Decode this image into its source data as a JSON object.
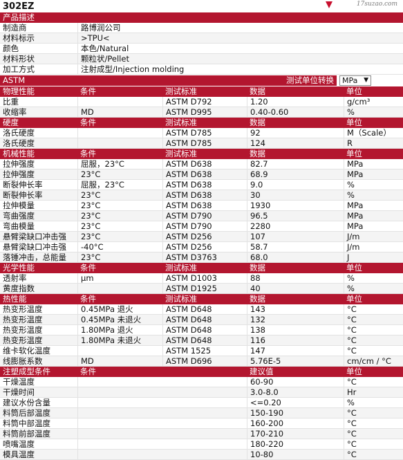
{
  "grade": "302EZ",
  "logo_text": "17suzao.com",
  "description": {
    "title": "产品描述",
    "rows": [
      {
        "label": "制造商",
        "value": "路博润公司"
      },
      {
        "label": "材料标示",
        "value": ">TPU<"
      },
      {
        "label": "颜色",
        "value": "本色/Natural"
      },
      {
        "label": "材料形状",
        "value": "颗粒状/Pellet"
      },
      {
        "label": "加工方式",
        "value": "注射成型/Injection molding"
      }
    ]
  },
  "astm_bar": {
    "label": "ASTM",
    "switch_label": "测试单位转换",
    "selected_unit": "MPa"
  },
  "sections": [
    {
      "title": "物理性能",
      "h_cond": "条件",
      "h_std": "测试标准",
      "h_data": "数据",
      "h_unit": "单位",
      "rows": [
        {
          "name": "比重",
          "cond": "",
          "std": "ASTM D792",
          "data": "1.20",
          "unit": "g/cm³"
        },
        {
          "name": "收缩率",
          "cond": "MD",
          "std": "ASTM D995",
          "data": "0.40-0.60",
          "unit": "%"
        }
      ]
    },
    {
      "title": "硬度",
      "h_cond": "条件",
      "h_std": "测试标准",
      "h_data": "数据",
      "h_unit": "单位",
      "rows": [
        {
          "name": "洛氏硬度",
          "cond": "",
          "std": "ASTM D785",
          "data": "92",
          "unit": "M（Scale）"
        },
        {
          "name": "洛氏硬度",
          "cond": "",
          "std": "ASTM D785",
          "data": "124",
          "unit": "R"
        }
      ]
    },
    {
      "title": "机械性能",
      "h_cond": "条件",
      "h_std": "测试标准",
      "h_data": "数据",
      "h_unit": "单位",
      "rows": [
        {
          "name": "拉伸强度",
          "cond": "屈服，23°C",
          "std": "ASTM D638",
          "data": "82.7",
          "unit": "MPa"
        },
        {
          "name": "拉伸强度",
          "cond": "23°C",
          "std": "ASTM D638",
          "data": "68.9",
          "unit": "MPa"
        },
        {
          "name": "断裂伸长率",
          "cond": "屈服，23°C",
          "std": "ASTM D638",
          "data": "9.0",
          "unit": "%"
        },
        {
          "name": "断裂伸长率",
          "cond": "23°C",
          "std": "ASTM D638",
          "data": "30",
          "unit": "%"
        },
        {
          "name": "拉伸模量",
          "cond": "23°C",
          "std": "ASTM D638",
          "data": "1930",
          "unit": "MPa"
        },
        {
          "name": "弯曲强度",
          "cond": "23°C",
          "std": "ASTM D790",
          "data": "96.5",
          "unit": "MPa"
        },
        {
          "name": "弯曲模量",
          "cond": "23°C",
          "std": "ASTM D790",
          "data": "2280",
          "unit": "MPa"
        },
        {
          "name": "悬臂梁缺口冲击强",
          "cond": "23°C",
          "std": "ASTM D256",
          "data": "107",
          "unit": "J/m"
        },
        {
          "name": "悬臂梁缺口冲击强",
          "cond": "-40°C",
          "std": "ASTM D256",
          "data": "58.7",
          "unit": "J/m"
        },
        {
          "name": "落锤冲击，总能量",
          "cond": "23°C",
          "std": "ASTM D3763",
          "data": "68.0",
          "unit": "J"
        }
      ]
    },
    {
      "title": "光学性能",
      "h_cond": "条件",
      "h_std": "测试标准",
      "h_data": "数据",
      "h_unit": "单位",
      "rows": [
        {
          "name": "透射率",
          "cond": "μm",
          "std": "ASTM D1003",
          "data": "88",
          "unit": "%"
        },
        {
          "name": "黄度指数",
          "cond": "",
          "std": "ASTM D1925",
          "data": "40",
          "unit": "%"
        }
      ]
    },
    {
      "title": "热性能",
      "h_cond": "条件",
      "h_std": "测试标准",
      "h_data": "数据",
      "h_unit": "单位",
      "rows": [
        {
          "name": "热变形温度",
          "cond": "0.45MPa 退火",
          "std": "ASTM D648",
          "data": "143",
          "unit": "°C"
        },
        {
          "name": "热变形温度",
          "cond": "0.45MPa 未退火",
          "std": "ASTM D648",
          "data": "132",
          "unit": "°C"
        },
        {
          "name": "热变形温度",
          "cond": "1.80MPa 退火",
          "std": "ASTM D648",
          "data": "138",
          "unit": "°C"
        },
        {
          "name": "热变形温度",
          "cond": "1.80MPa 未退火",
          "std": "ASTM D648",
          "data": "116",
          "unit": "°C"
        },
        {
          "name": "维卡软化温度",
          "cond": "",
          "std": "ASTM 1525",
          "data": "147",
          "unit": "°C"
        },
        {
          "name": "线膨胀系数",
          "cond": "MD",
          "std": "ASTM D696",
          "data": "5.76E-5",
          "unit": "cm/cm / °C"
        }
      ]
    }
  ],
  "molding": {
    "title": "注塑成型条件",
    "h_cond": "条件",
    "h_value": "建议值",
    "h_unit": "单位",
    "rows": [
      {
        "name": "干燥温度",
        "value": "60-90",
        "unit": "°C"
      },
      {
        "name": "干燥时间",
        "value": "3.0-8.0",
        "unit": "Hr"
      },
      {
        "name": "建议水份含量",
        "value": "<=0.20",
        "unit": "%"
      },
      {
        "name": "料筒后部温度",
        "value": "150-190",
        "unit": "°C"
      },
      {
        "name": "料筒中部温度",
        "value": "160-200",
        "unit": "°C"
      },
      {
        "name": "料筒前部温度",
        "value": "170-210",
        "unit": "°C"
      },
      {
        "name": "喷嘴温度",
        "value": "180-220",
        "unit": "°C"
      },
      {
        "name": "模具温度",
        "value": "10-80",
        "unit": "°C"
      }
    ]
  }
}
